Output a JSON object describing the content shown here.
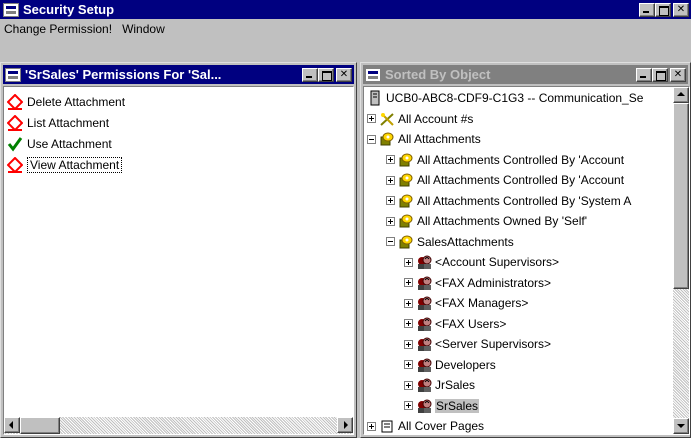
{
  "app": {
    "title": "Security Setup"
  },
  "menu": {
    "items": [
      "Change Permission!",
      "Window"
    ]
  },
  "permissions_window": {
    "title": "'SrSales' Permissions For 'Sal...",
    "items": [
      {
        "label": "Delete Attachment",
        "icon": "not-granted-icon"
      },
      {
        "label": "List Attachment",
        "icon": "not-granted-icon"
      },
      {
        "label": "Use Attachment",
        "icon": "granted-check-icon"
      },
      {
        "label": "View Attachment",
        "icon": "not-granted-icon"
      }
    ]
  },
  "object_window": {
    "title": "Sorted By Object",
    "tree": [
      {
        "label": "UCB0-ABC8-CDF9-C1G3 -- Communication_Se",
        "icon": "server-icon",
        "level": 0,
        "expander": "none"
      },
      {
        "label": "All Account #s",
        "icon": "account-icon",
        "level": 1,
        "expander": "plus"
      },
      {
        "label": "All Attachments",
        "icon": "attachment-group-icon",
        "level": 1,
        "expander": "minus"
      },
      {
        "label": "All Attachments Controlled By 'Account",
        "icon": "attachment-group-icon",
        "level": 2,
        "expander": "plus"
      },
      {
        "label": "All Attachments Controlled By 'Account",
        "icon": "attachment-group-icon",
        "level": 2,
        "expander": "plus"
      },
      {
        "label": "All Attachments Controlled By 'System A",
        "icon": "attachment-group-icon",
        "level": 2,
        "expander": "plus"
      },
      {
        "label": "All Attachments Owned By 'Self'",
        "icon": "attachment-group-icon",
        "level": 2,
        "expander": "plus"
      },
      {
        "label": "SalesAttachments",
        "icon": "attachment-group-icon",
        "level": 2,
        "expander": "minus"
      },
      {
        "label": "<Account Supervisors>",
        "icon": "user-group-icon",
        "level": 3,
        "expander": "plus"
      },
      {
        "label": "<FAX Administrators>",
        "icon": "user-group-icon",
        "level": 3,
        "expander": "plus"
      },
      {
        "label": "<FAX Managers>",
        "icon": "user-group-icon",
        "level": 3,
        "expander": "plus"
      },
      {
        "label": "<FAX Users>",
        "icon": "user-group-icon",
        "level": 3,
        "expander": "plus"
      },
      {
        "label": "<Server Supervisors>",
        "icon": "user-group-icon",
        "level": 3,
        "expander": "plus"
      },
      {
        "label": "Developers",
        "icon": "user-group-icon",
        "level": 3,
        "expander": "plus"
      },
      {
        "label": "JrSales",
        "icon": "user-group-icon",
        "level": 3,
        "expander": "plus"
      },
      {
        "label": "SrSales",
        "icon": "user-group-icon",
        "level": 3,
        "expander": "plus",
        "selected": true
      },
      {
        "label": "All Cover Pages",
        "icon": "cover-pages-icon",
        "level": 1,
        "expander": "plus"
      }
    ]
  },
  "colors": {
    "active_title": "#000080",
    "inactive_title": "#808080",
    "face": "#c0c0c0",
    "granted": "#008000",
    "not_granted": "#ff0000"
  }
}
